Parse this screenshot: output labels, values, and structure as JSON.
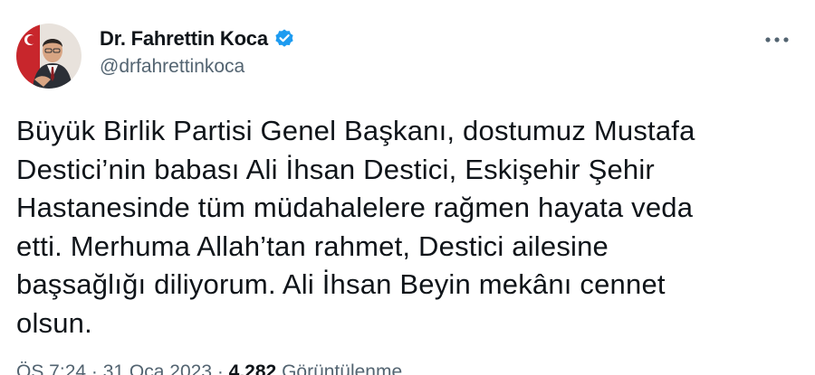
{
  "author": {
    "display_name": "Dr. Fahrettin Koca",
    "handle": "@drfahrettinkoca",
    "verified": true
  },
  "tweet": {
    "text": "Büyük Birlik Partisi Genel Başkanı, dostumuz Mustafa\nDestici’nin babası Ali İhsan Destici, Eskişehir Şehir\nHastanesinde tüm müdahalelere rağmen hayata veda\netti. Merhuma Allah’tan rahmet, Destici ailesine\nbaşsağlığı diliyorum. Ali İhsan Beyin mekânı cennet\nolsun."
  },
  "meta": {
    "time": "ÖS 7:24",
    "separator": " · ",
    "date": "31 Oca 2023",
    "views_count": "4.282",
    "views_label": " Görüntülenme"
  },
  "colors": {
    "text": "#0f1419",
    "secondary": "#536471",
    "verified": "#1d9bf0"
  },
  "icons": {
    "verified": "verified-badge-icon",
    "more": "more-horizontal-icon"
  }
}
